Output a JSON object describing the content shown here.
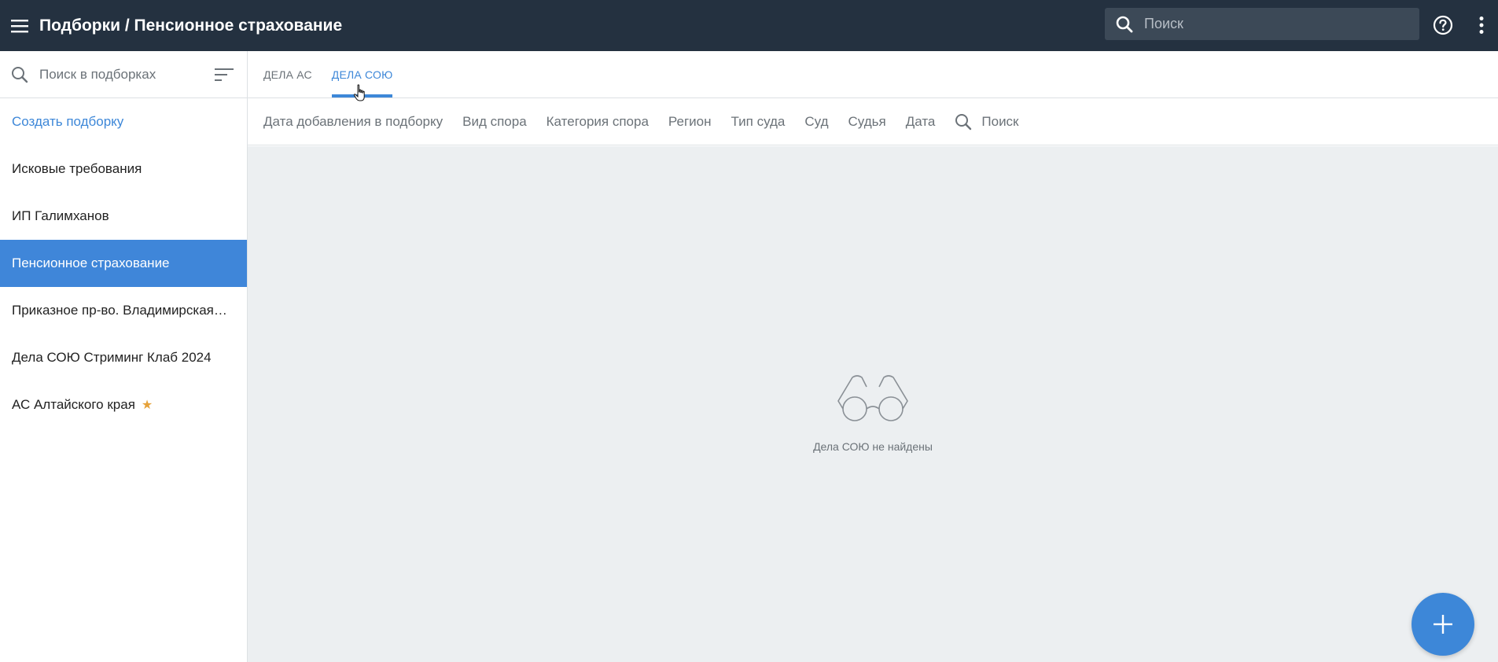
{
  "header": {
    "title": "Подборки / Пенсионное страхование",
    "search_placeholder": "Поиск"
  },
  "sidebar": {
    "search_placeholder": "Поиск в подборках",
    "create_label": "Создать подборку",
    "items": [
      {
        "label": "Исковые требования",
        "active": false,
        "starred": false
      },
      {
        "label": "ИП Галимханов",
        "active": false,
        "starred": false
      },
      {
        "label": "Пенсионное страхование",
        "active": true,
        "starred": false
      },
      {
        "label": "Приказное пр-во. Владимирская о...",
        "active": false,
        "starred": false
      },
      {
        "label": "Дела СОЮ Стриминг Клаб 2024",
        "active": false,
        "starred": false
      },
      {
        "label": "АС Алтайского края",
        "active": false,
        "starred": true
      }
    ]
  },
  "tabs": [
    {
      "label": "Дела АС",
      "active": false
    },
    {
      "label": "Дела СОЮ",
      "active": true
    }
  ],
  "filters": {
    "items": [
      "Дата добавления в подборку",
      "Вид спора",
      "Категория спора",
      "Регион",
      "Тип суда",
      "Суд",
      "Судья",
      "Дата"
    ],
    "search_label": "Поиск"
  },
  "empty_state": {
    "message": "Дела СОЮ не найдены",
    "icon": "glasses-icon"
  },
  "colors": {
    "topbar": "#243140",
    "accent": "#3d87d8",
    "active_item": "#3f86d9",
    "star": "#e6a23a",
    "content_bg": "#eceff1"
  }
}
